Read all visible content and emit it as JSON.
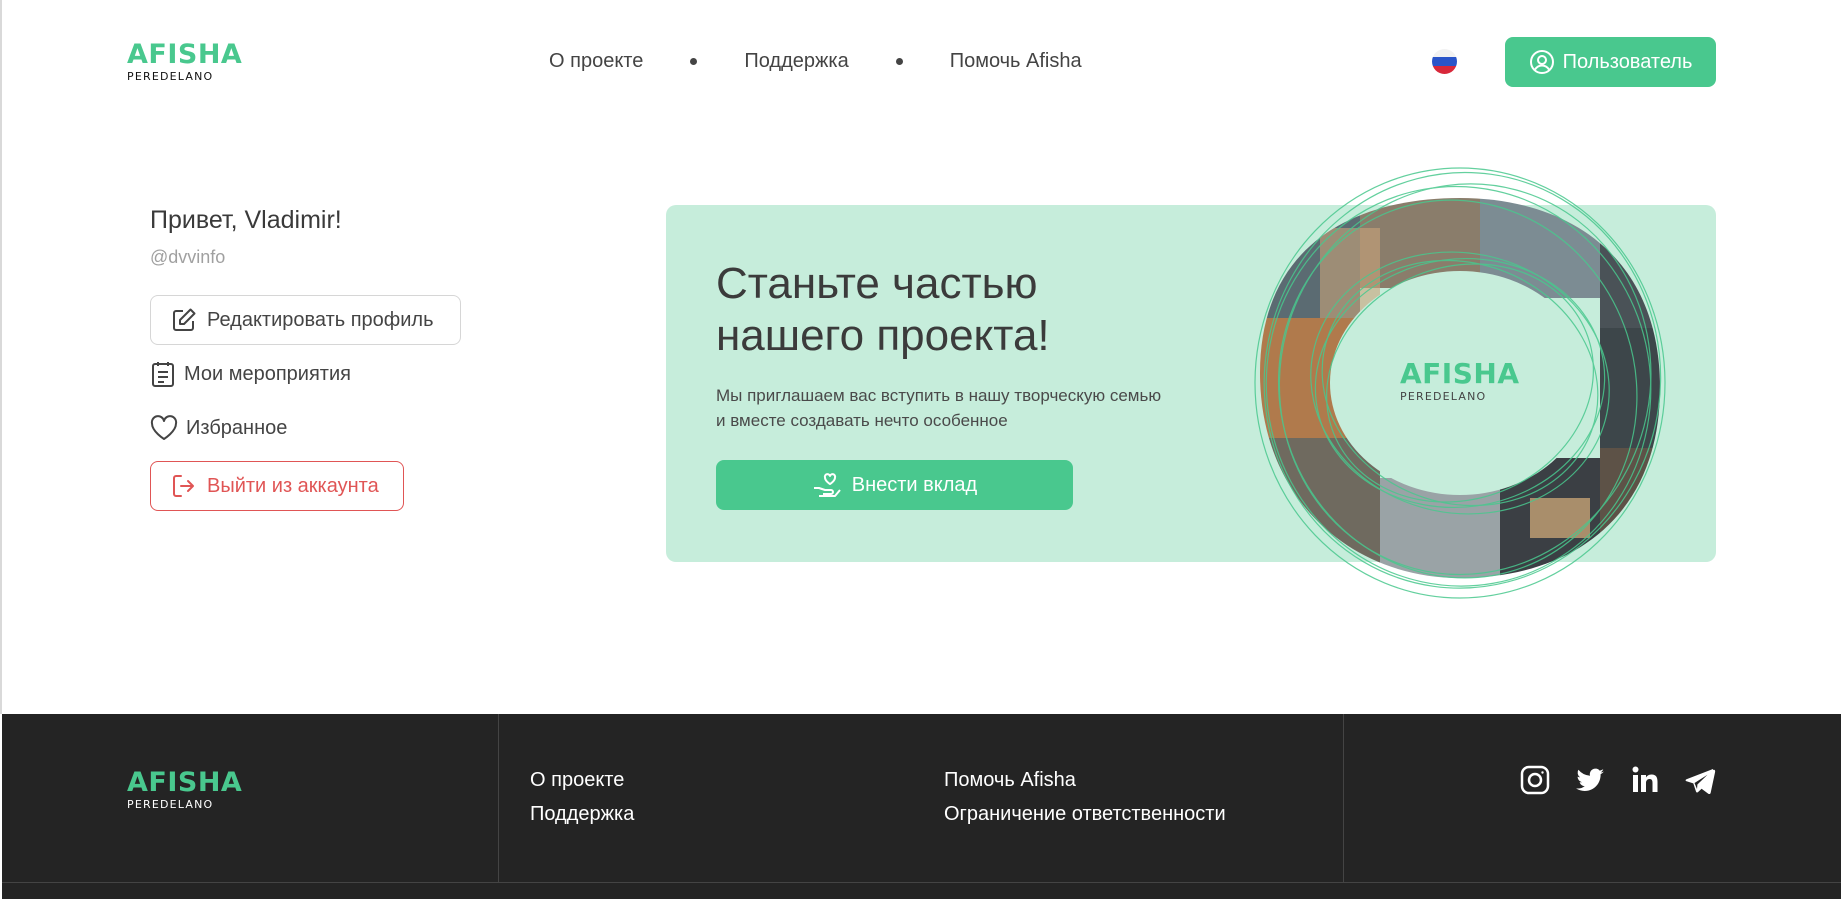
{
  "brand": {
    "name": "AFISHA",
    "sub": "PEREDELANO",
    "accent": "#49c88e"
  },
  "header": {
    "nav": [
      "О проекте",
      "Поддержка",
      "Помочь Afisha"
    ],
    "language_icon": "russia-flag-icon",
    "user_button": "Пользователь"
  },
  "profile": {
    "greeting": "Привет, Vladimir!",
    "username": "@dvvinfo",
    "edit_button": "Редактировать профиль",
    "events": "Мои мероприятия",
    "favorites": "Избранное",
    "logout_button": "Выйти из аккаунта"
  },
  "promo": {
    "title": "Станьте частью нашего проекта!",
    "text": "Мы приглашаем вас вступить в нашу творческую семью и вместе создавать нечто особенное",
    "button": "Внести вклад"
  },
  "footer": {
    "links_col1": [
      "О проекте",
      "Поддержка"
    ],
    "links_col2": [
      "Помочь Afisha",
      "Ограничение ответственности"
    ],
    "social_icons": [
      "instagram-icon",
      "twitter-icon",
      "linkedin-icon",
      "telegram-icon"
    ]
  }
}
